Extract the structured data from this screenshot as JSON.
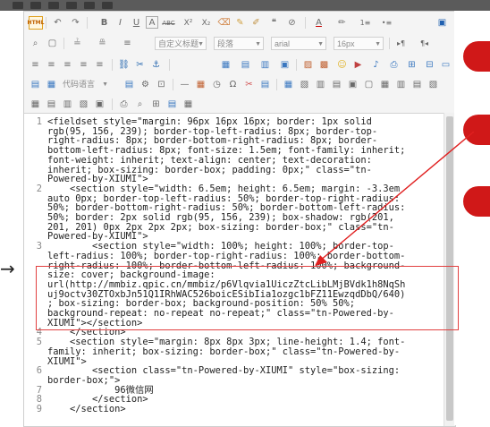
{
  "toolbar": {
    "row1_icons": [
      "html-icon",
      "undo-icon",
      "redo-icon",
      "bold-icon",
      "italic-icon",
      "underline-icon",
      "font-border-icon",
      "strikethrough-icon",
      "superscript-icon",
      "subscript-icon",
      "eraser-icon",
      "format-match-icon",
      "pen-icon",
      "blockquote-icon",
      "clear-format-icon",
      "font-color-icon",
      "highlight-icon",
      "ordered-list-icon",
      "unordered-list-icon",
      "fullscreen-icon"
    ],
    "row1_glyphs": {
      "html": "HTML",
      "undo": "↶",
      "redo": "↷",
      "bold": "B",
      "italic": "I",
      "underline": "U",
      "font_border": "A",
      "strike": "ABC",
      "sup": "X²",
      "sub": "X₂",
      "eraser": "⌫",
      "format": "✎",
      "pen": "✐",
      "quote": "❝",
      "clear": "⊘",
      "font_color": "A",
      "highlight": "✏",
      "ol": "1≡",
      "ul": "•≡",
      "full": "▣"
    },
    "row2": {
      "custom_title": "自定义标题",
      "paragraph": "段落",
      "font_family": "arial",
      "font_size": "16px"
    },
    "row4": {
      "code_language": "代码语言"
    }
  },
  "code_lines": [
    {
      "ln": "1",
      "text": "<fieldset style=\"margin: 96px 16px 16px; border: 1px solid"
    },
    {
      "ln": "",
      "text": "rgb(95, 156, 239); border-top-left-radius: 8px; border-top-"
    },
    {
      "ln": "",
      "text": "right-radius: 8px; border-bottom-right-radius: 8px; border-"
    },
    {
      "ln": "",
      "text": "bottom-left-radius: 8px; font-size: 1.5em; font-family: inherit;"
    },
    {
      "ln": "",
      "text": "font-weight: inherit; text-align: center; text-decoration:"
    },
    {
      "ln": "",
      "text": "inherit; box-sizing: border-box; padding: 0px;\" class=\"tn-"
    },
    {
      "ln": "",
      "text": "Powered-by-XIUMI\">"
    },
    {
      "ln": "2",
      "text": "    <section style=\"width: 6.5em; height: 6.5em; margin: -3.3em"
    },
    {
      "ln": "",
      "text": "auto 0px; border-top-left-radius: 50%; border-top-right-radius:"
    },
    {
      "ln": "",
      "text": "50%; border-bottom-right-radius: 50%; border-bottom-left-radius:"
    },
    {
      "ln": "",
      "text": "50%; border: 2px solid rgb(95, 156, 239); box-shadow: rgb(201,"
    },
    {
      "ln": "",
      "text": "201, 201) 0px 2px 2px 2px; box-sizing: border-box;\" class=\"tn-"
    },
    {
      "ln": "",
      "text": "Powered-by-XIUMI\">"
    },
    {
      "ln": "3",
      "text": "        <section style=\"width: 100%; height: 100%; border-top-"
    },
    {
      "ln": "",
      "text": "left-radius: 100%; border-top-right-radius: 100%; border-bottom-"
    },
    {
      "ln": "",
      "text": "right-radius: 100%; border-bottom-left-radius: 100%; background-"
    },
    {
      "ln": "",
      "text": "size: cover; background-image:"
    },
    {
      "ln": "",
      "text": "url(http://mmbiz.qpic.cn/mmbiz/p6Vlqvia1UiczZtcLibLMjBVdk1h8NqSh"
    },
    {
      "ln": "",
      "text": "uj9octv30ZTOxbJn51Q1IRhWAC526boicESibIia1ozgc1bFZ11EwzqdDbQ/640)"
    },
    {
      "ln": "",
      "text": "; box-sizing: border-box; background-position: 50% 50%;"
    },
    {
      "ln": "",
      "text": "background-repeat: no-repeat no-repeat;\" class=\"tn-Powered-by-"
    },
    {
      "ln": "",
      "text": "XIUMI\"></section>"
    },
    {
      "ln": "4",
      "text": "    </section>"
    },
    {
      "ln": "5",
      "text": "    <section style=\"margin: 8px 8px 3px; line-height: 1.4; font-"
    },
    {
      "ln": "",
      "text": "family: inherit; box-sizing: border-box;\" class=\"tn-Powered-by-"
    },
    {
      "ln": "",
      "text": "XIUMI\">"
    },
    {
      "ln": "6",
      "text": "        <section class=\"tn-Powered-by-XIUMI\" style=\"box-sizing:"
    },
    {
      "ln": "",
      "text": "border-box;\">"
    },
    {
      "ln": "7",
      "text": "            96微信网"
    },
    {
      "ln": "8",
      "text": "        </section>"
    },
    {
      "ln": "9",
      "text": "    </section>"
    }
  ],
  "colors": {
    "highlight_border": "#e24040",
    "arrow_red": "#e02020",
    "accent_red": "#d01818"
  },
  "left_arrow": "→"
}
